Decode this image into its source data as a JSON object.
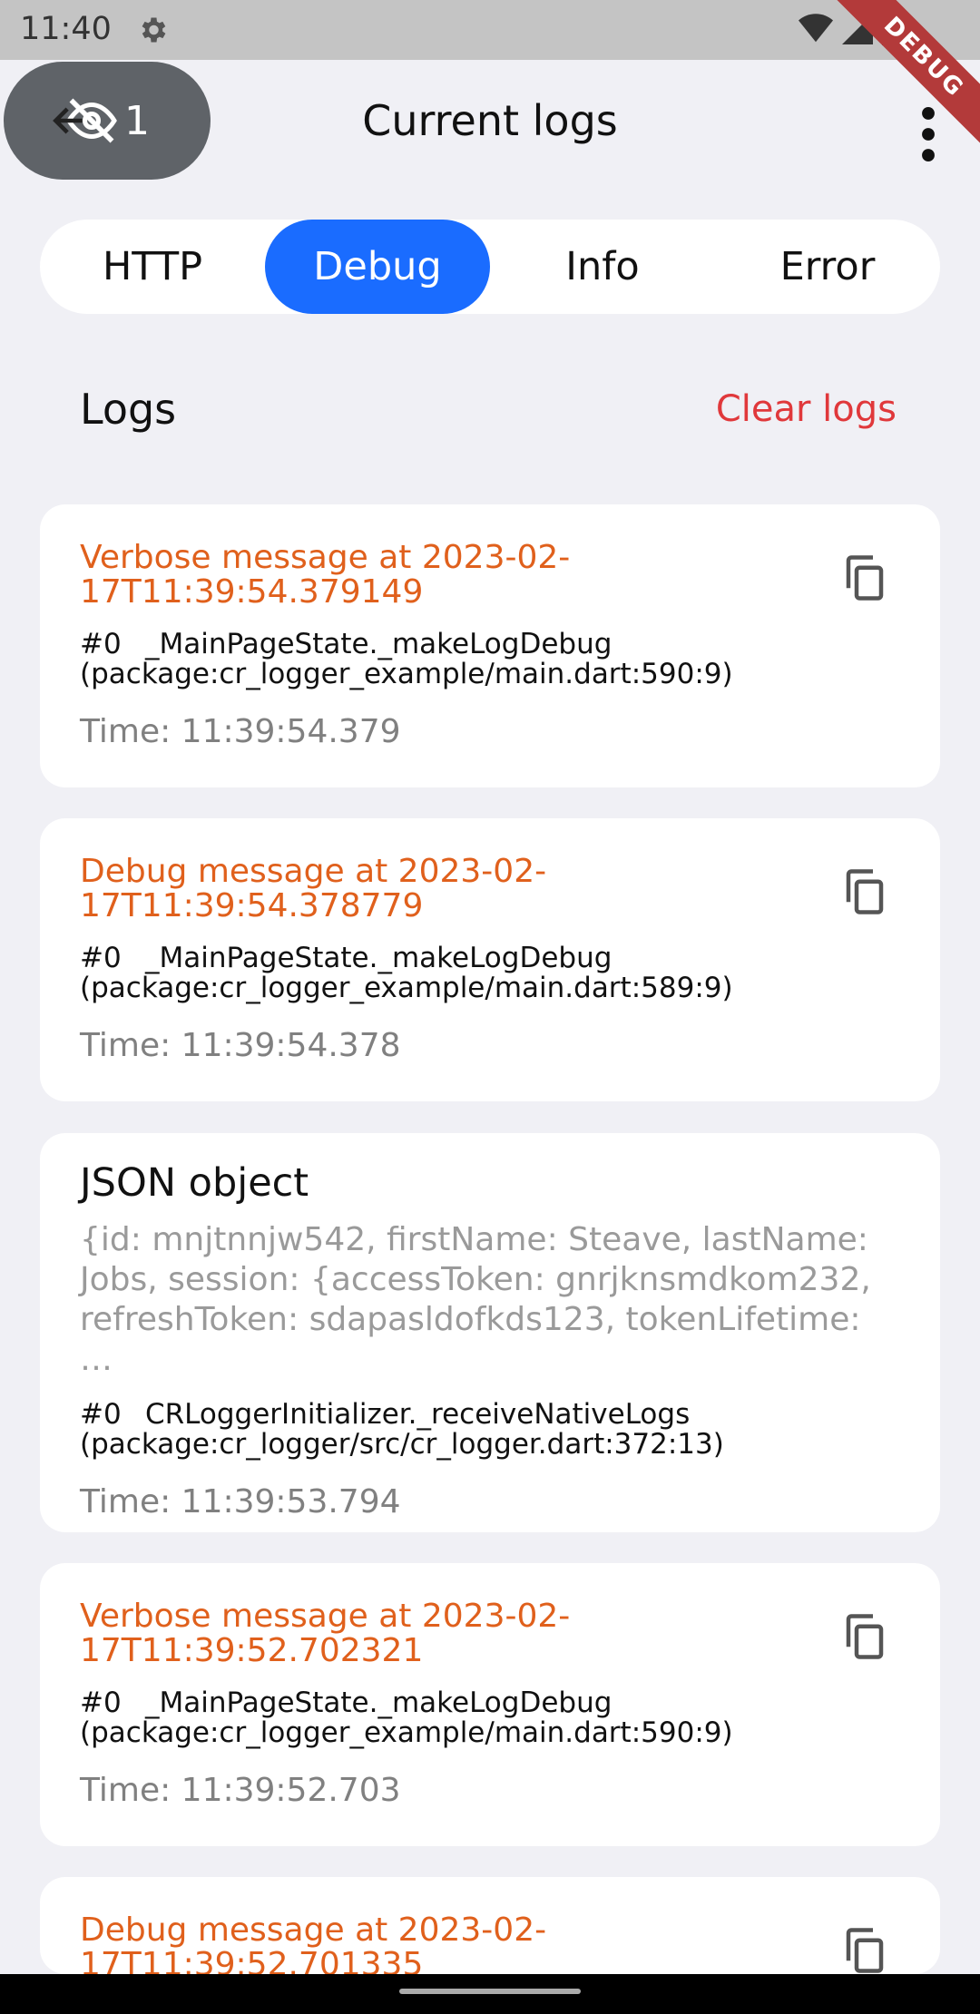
{
  "status": {
    "time": "11:40",
    "debug_ribbon": "DEBUG"
  },
  "appbar": {
    "title": "Current logs",
    "hidden_count": "1"
  },
  "tabs": [
    {
      "label": "HTTP",
      "active": false
    },
    {
      "label": "Debug",
      "active": true
    },
    {
      "label": "Info",
      "active": false
    },
    {
      "label": "Error",
      "active": false
    }
  ],
  "section": {
    "title": "Logs",
    "clear_label": "Clear logs"
  },
  "logs": [
    {
      "title": "Verbose message at 2023-02-17T11:39:54.379149",
      "trace_num": "#0",
      "trace_fn": "_MainPageState._makeLogDebug",
      "trace_loc": "(package:cr_logger_example/main.dart:590:9)",
      "time": "Time: 11:39:54.379"
    },
    {
      "title": "Debug message at 2023-02-17T11:39:54.378779",
      "trace_num": "#0",
      "trace_fn": "_MainPageState._makeLogDebug",
      "trace_loc": "(package:cr_logger_example/main.dart:589:9)",
      "time": "Time: 11:39:54.378"
    },
    {
      "title": "JSON object",
      "json": "{id: mnjtnnjw542, firstName: Steave, lastName: Jobs, session: {accessToken: gnrjknsmdkom232, refreshToken: sdapasldofkds123, tokenLifetime: …",
      "trace_num": "#0",
      "trace_fn": "CRLoggerInitializer._receiveNativeLogs",
      "trace_loc": "(package:cr_logger/src/cr_logger.dart:372:13)",
      "time": "Time: 11:39:53.794"
    },
    {
      "title": "Verbose message at 2023-02-17T11:39:52.702321",
      "trace_num": "#0",
      "trace_fn": "_MainPageState._makeLogDebug",
      "trace_loc": "(package:cr_logger_example/main.dart:590:9)",
      "time": "Time: 11:39:52.703"
    },
    {
      "title": "Debug message at 2023-02-17T11:39:52.701335"
    }
  ],
  "colors": {
    "accent": "#1a6cff",
    "log_title": "#e0601c",
    "clear": "#e0383b"
  },
  "icons": [
    "gear-icon",
    "wifi-icon",
    "signal-icon",
    "battery-icon",
    "back-arrow-icon",
    "eye-off-icon",
    "more-vert-icon",
    "copy-icon"
  ]
}
